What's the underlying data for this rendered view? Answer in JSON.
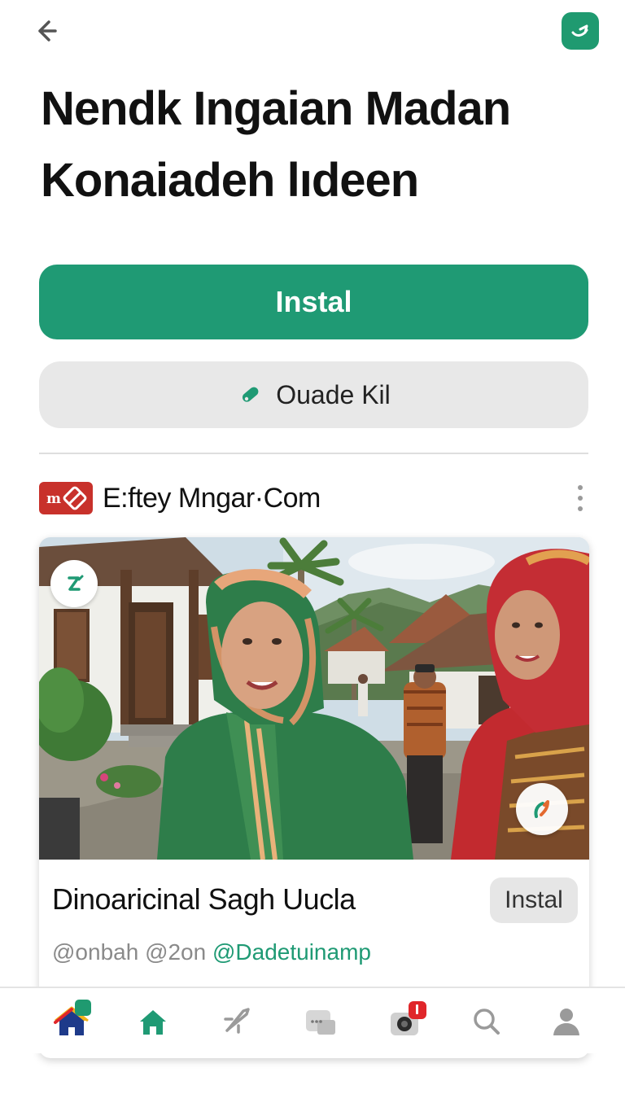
{
  "header": {
    "back_icon": "arrow-left-icon",
    "app_icon": "app-badge-icon",
    "title_line1": "Nendk Ingaian Madan",
    "title_line2": "Konaiadeh lıdeen"
  },
  "actions": {
    "primary_label": "Instal",
    "secondary_label": "Ouade Kil",
    "secondary_icon": "pencil-tag-icon"
  },
  "source": {
    "name": "E:ftey Mngar·Com",
    "logo_icon": "source-logo-icon",
    "more_icon": "kebab-menu-icon"
  },
  "card": {
    "title": "Dinoaricinal Sagh Uucla",
    "install_label": "Instal",
    "meta_gray": "@onbah @2on ",
    "meta_green": "@Dadetuinamp",
    "photo_icon_left": "share-badge-icon",
    "photo_icon_right": "swipe-badge-icon"
  },
  "bottom_nav": {
    "items": [
      "home-color-icon",
      "home-icon",
      "rocket-icon",
      "cards-icon",
      "camera-icon",
      "search-icon",
      "profile-icon"
    ],
    "active": "home-icon"
  },
  "colors": {
    "accent": "#1f9a74",
    "button_gray": "#e8e8e8",
    "badge_red": "#e0262a",
    "logo_red": "#c8312b"
  }
}
